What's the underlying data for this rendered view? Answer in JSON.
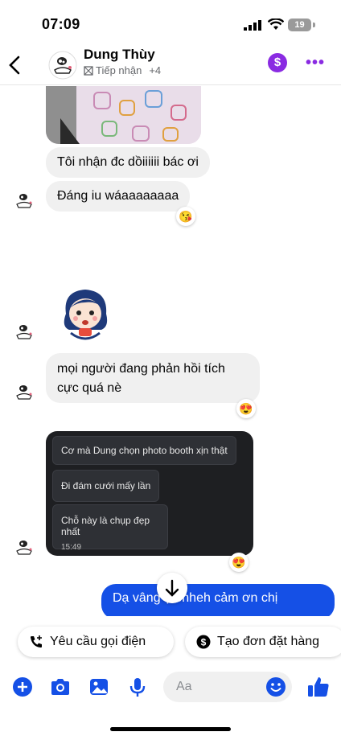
{
  "status": {
    "time": "07:09",
    "battery": "19"
  },
  "header": {
    "name": "Dung Thùy",
    "sub_label": "Tiếp nhận",
    "extra_count": "+4",
    "payment_symbol": "$"
  },
  "messages": {
    "m1": "Tôi nhận đc dồiiiiii bác ơi",
    "m2": "Đáng iu wáaaaaaaaa",
    "m2_reaction": "😘",
    "m3": "mọi người đang phản hồi tích cực quá nè",
    "m3_reaction": "😍",
    "card": {
      "line1": "Cơ mà Dung chọn photo booth xịn thật",
      "line2": "Đi đám cưới mấy lần",
      "line3": "Chỗ này là chụp đẹp nhất",
      "time": "15:49"
    },
    "card_reaction": "😍",
    "outgoing": "Dạ vâng ạ ehheh cảm ơn chị"
  },
  "actions": {
    "call": "Yêu cầu gọi điện",
    "order": "Tạo đơn đặt hàng"
  },
  "composer": {
    "placeholder": "Aa"
  },
  "colors": {
    "accent": "#1550e6",
    "brand_purple": "#8a2be2"
  }
}
